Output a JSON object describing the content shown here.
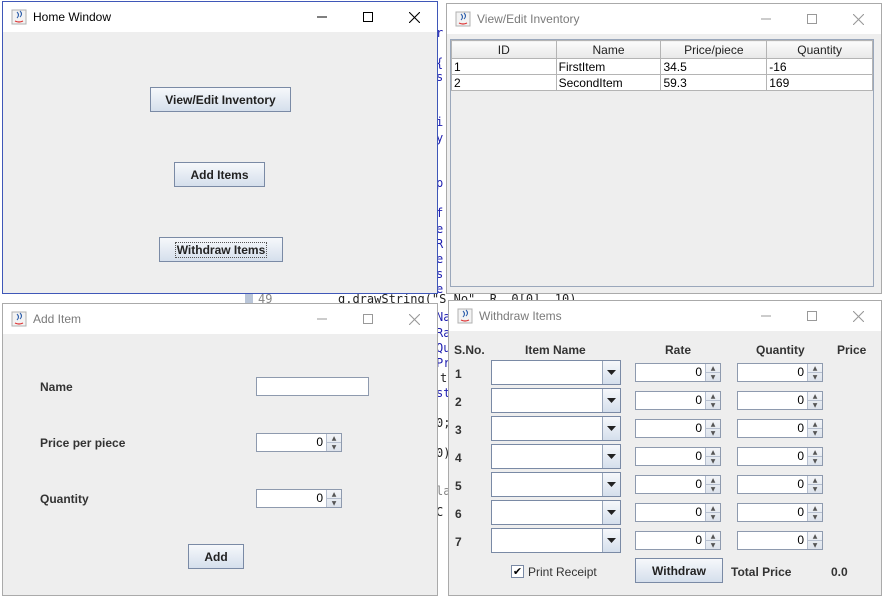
{
  "editor": {
    "lines": [
      "r",
      "{",
      "s",
      "i",
      "y",
      "p",
      "f",
      "e",
      "R",
      "e",
      "s",
      "e",
      "49",
      "g.drawString(\"S.No\", R, 0[0], 10)",
      "Na",
      "Ra",
      "Qu",
      "Pr",
      "t",
      "st",
      "0;",
      "0)",
      "la",
      "C"
    ]
  },
  "home_window": {
    "title": "Home Window",
    "view_edit_label": "View/Edit Inventory",
    "add_items_label": "Add Items",
    "withdraw_items_label": "Withdraw Items"
  },
  "inventory_window": {
    "title": "View/Edit Inventory",
    "columns": [
      "ID",
      "Name",
      "Price/piece",
      "Quantity"
    ],
    "rows": [
      [
        "1",
        "FirstItem",
        "34.5",
        "-16"
      ],
      [
        "2",
        "SecondItem",
        "59.3",
        "169"
      ]
    ]
  },
  "add_item_window": {
    "title": "Add Item",
    "name_label": "Name",
    "name_value": "",
    "price_label": "Price per piece",
    "price_value": "0",
    "quantity_label": "Quantity",
    "quantity_value": "0",
    "add_label": "Add"
  },
  "withdraw_window": {
    "title": "Withdraw Items",
    "headers": {
      "sno": "S.No.",
      "item_name": "Item Name",
      "rate": "Rate",
      "quantity": "Quantity",
      "price": "Price"
    },
    "rows": [
      {
        "sno": "1",
        "rate": "0",
        "quantity": "0"
      },
      {
        "sno": "2",
        "rate": "0",
        "quantity": "0"
      },
      {
        "sno": "3",
        "rate": "0",
        "quantity": "0"
      },
      {
        "sno": "4",
        "rate": "0",
        "quantity": "0"
      },
      {
        "sno": "5",
        "rate": "0",
        "quantity": "0"
      },
      {
        "sno": "6",
        "rate": "0",
        "quantity": "0"
      },
      {
        "sno": "7",
        "rate": "0",
        "quantity": "0"
      }
    ],
    "print_receipt_label": "Print Receipt",
    "print_receipt_checked": true,
    "check_mark": "✔",
    "withdraw_label": "Withdraw",
    "total_price_label": "Total Price",
    "total_price_value": "0.0"
  },
  "window_controls": {
    "minimize": "minimize",
    "maximize": "maximize",
    "close": "close"
  }
}
